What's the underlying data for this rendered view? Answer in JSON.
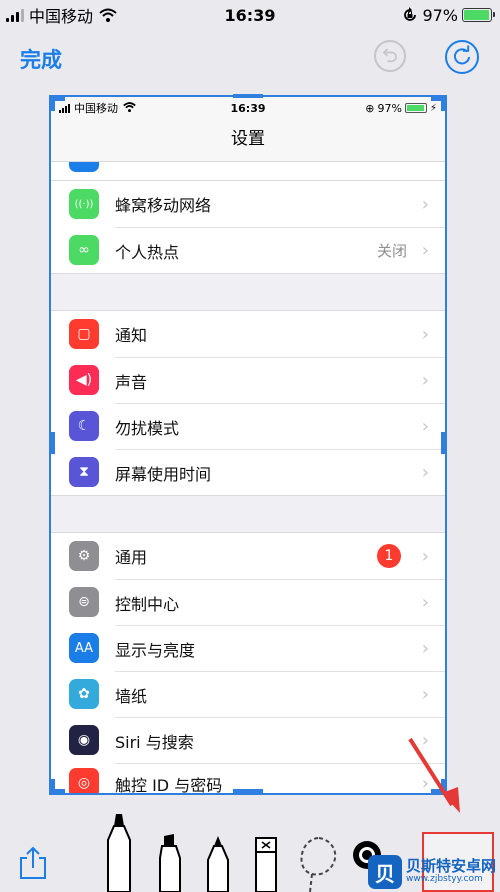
{
  "status": {
    "carrier": "中国移动",
    "time": "16:39",
    "battery": "97%",
    "battery_level": 0.97
  },
  "toolbar": {
    "done_label": "完成",
    "undo_icon": "undo-icon",
    "redo_icon": "redo-icon",
    "accent": "#1a7de8"
  },
  "preview": {
    "status": {
      "carrier": "中国移动",
      "time": "16:39",
      "battery": "97%"
    },
    "title": "设置",
    "group1": [
      {
        "label": "蜂窝移动网络",
        "icon": "antenna-icon",
        "color": "#4cd964"
      },
      {
        "label": "个人热点",
        "icon": "hotspot-icon",
        "color": "#4cd964",
        "detail": "关闭"
      }
    ],
    "group2": [
      {
        "label": "通知",
        "icon": "notification-icon",
        "color": "#ff3b30"
      },
      {
        "label": "声音",
        "icon": "speaker-icon",
        "color": "#ff2d55"
      },
      {
        "label": "勿扰模式",
        "icon": "moon-icon",
        "color": "#5856d6"
      },
      {
        "label": "屏幕使用时间",
        "icon": "hourglass-icon",
        "color": "#5856d6"
      }
    ],
    "group3": [
      {
        "label": "通用",
        "icon": "gear-icon",
        "color": "#8e8e93",
        "badge": "1"
      },
      {
        "label": "控制中心",
        "icon": "toggles-icon",
        "color": "#8e8e93"
      },
      {
        "label": "显示与亮度",
        "icon": "text-size-icon",
        "color": "#1a7de8",
        "icon_text": "AA"
      },
      {
        "label": "墙纸",
        "icon": "flower-icon",
        "color": "#34aadc"
      },
      {
        "label": "Siri 与搜索",
        "icon": "siri-icon",
        "color": "#222244"
      },
      {
        "label": "触控 ID 与密码",
        "icon": "fingerprint-icon",
        "color": "#ff3b30"
      }
    ]
  },
  "tools": {
    "share_icon": "share-icon",
    "items": [
      "marker-icon",
      "highlighter-icon",
      "pencil-icon",
      "eraser-icon",
      "lasso-icon",
      "color-picker-icon"
    ]
  },
  "watermark": {
    "logo_letter": "贝",
    "name": "贝斯特安卓网",
    "url": "www.zjbstyy.com"
  }
}
